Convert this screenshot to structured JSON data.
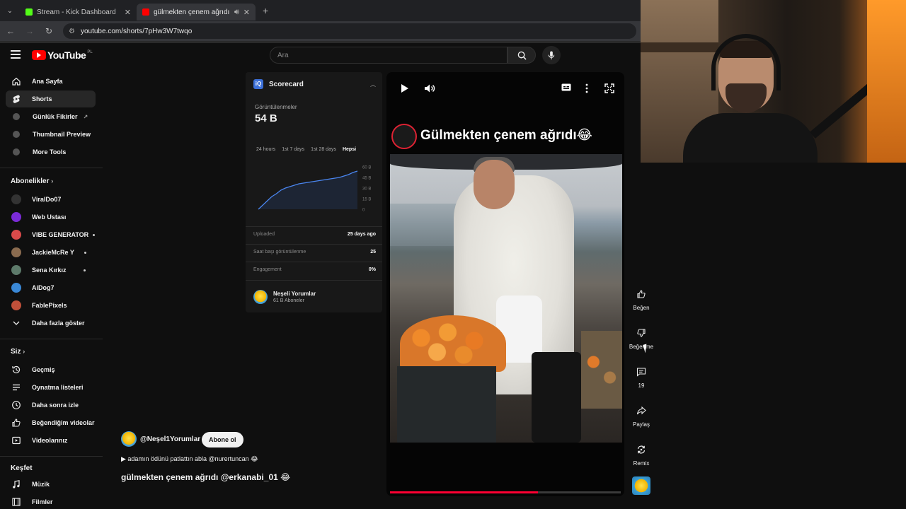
{
  "browser": {
    "tabs": [
      {
        "label": "Stream - Kick Dashboard",
        "favicon_color": "#53fc18",
        "active": false
      },
      {
        "label": "gülmekten çenem ağrıdı 😂",
        "favicon_color": "#ff0000",
        "active": true
      }
    ],
    "url": "youtube.com/shorts/7pHw3W7twqo"
  },
  "youtube": {
    "logo_text": "YouTube",
    "country_code": "PL",
    "search_placeholder": "Ara"
  },
  "sidebar": {
    "main": [
      {
        "label": "Ana Sayfa",
        "icon": "home-icon",
        "active": false
      },
      {
        "label": "Shorts",
        "icon": "shorts-icon",
        "active": true
      },
      {
        "label": "Günlük Fikirler",
        "icon": "extension-icon",
        "active": false
      },
      {
        "label": "Thumbnail Preview",
        "icon": "extension-icon",
        "active": false
      },
      {
        "label": "More Tools",
        "icon": "extension-icon",
        "active": false
      }
    ],
    "subscriptions_heading": "Abonelikler",
    "subscriptions": [
      {
        "label": "ViralDo07",
        "color": "#333333"
      },
      {
        "label": "Web Ustası",
        "color": "#7b2bd6"
      },
      {
        "label": "VIBE GENERATOR",
        "color": "#d94a4a"
      },
      {
        "label": "JackieMcRe Y",
        "color": "#8a6b4f"
      },
      {
        "label": "Sena Kırkız",
        "color": "#5d7a6a"
      },
      {
        "label": "AiDog7",
        "color": "#3a88d6"
      },
      {
        "label": "FablePixels",
        "color": "#c0503a"
      }
    ],
    "show_more": "Daha fazla göster",
    "you_heading": "Siz",
    "you": [
      {
        "label": "Geçmiş",
        "icon": "history-icon"
      },
      {
        "label": "Oynatma listeleri",
        "icon": "playlist-icon"
      },
      {
        "label": "Daha sonra izle",
        "icon": "clock-icon"
      },
      {
        "label": "Beğendiğim videolar",
        "icon": "thumbs-up-icon"
      },
      {
        "label": "Videolarınız",
        "icon": "your-videos-icon"
      }
    ],
    "explore_heading": "Keşfet",
    "explore": [
      {
        "label": "Müzik",
        "icon": "music-icon"
      },
      {
        "label": "Filmler",
        "icon": "film-icon"
      }
    ]
  },
  "scorecard": {
    "title": "Scorecard",
    "views_label": "Görüntülenmeler",
    "views_value": "54 B",
    "ranges": [
      "24 hours",
      "1st 7 days",
      "1st 28 days",
      "Hepsi"
    ],
    "active_range": "Hepsi",
    "stats": [
      {
        "label": "Uploaded",
        "value": "25 days ago"
      },
      {
        "label": "Saat başı görüntülenme",
        "value": "25"
      },
      {
        "label": "Engagement",
        "value": "0%"
      }
    ],
    "channel_name": "Neşeli Yorumlar",
    "channel_subs": "61 B Aboneler"
  },
  "chart_data": {
    "type": "line",
    "title": "",
    "xlabel": "",
    "ylabel": "",
    "y_ticks": [
      "60 B",
      "45 B",
      "30 B",
      "15 B",
      "0"
    ],
    "ylim": [
      0,
      60
    ],
    "grid": false,
    "series": [
      {
        "values": [
          0,
          6,
          12,
          18,
          22,
          27,
          30,
          32,
          34,
          36,
          37,
          38,
          39,
          40,
          41,
          42,
          43,
          44,
          45,
          47,
          49,
          52,
          54
        ]
      }
    ]
  },
  "player": {
    "title": "Gülmekten çenem ağrıdı😂",
    "progress": 0.64
  },
  "actions": {
    "like": "Beğen",
    "dislike": "Beğenme",
    "comments": "19",
    "share": "Paylaş",
    "remix": "Remix"
  },
  "meta": {
    "channel": "@Neşel1Yorumlar",
    "subscribe": "Abone ol",
    "song": "▶ adamın ödünü patlattın abla @nurertuncan 😂",
    "title": "gülmekten çenem ağrıdı @erkanabi_01 😂"
  }
}
